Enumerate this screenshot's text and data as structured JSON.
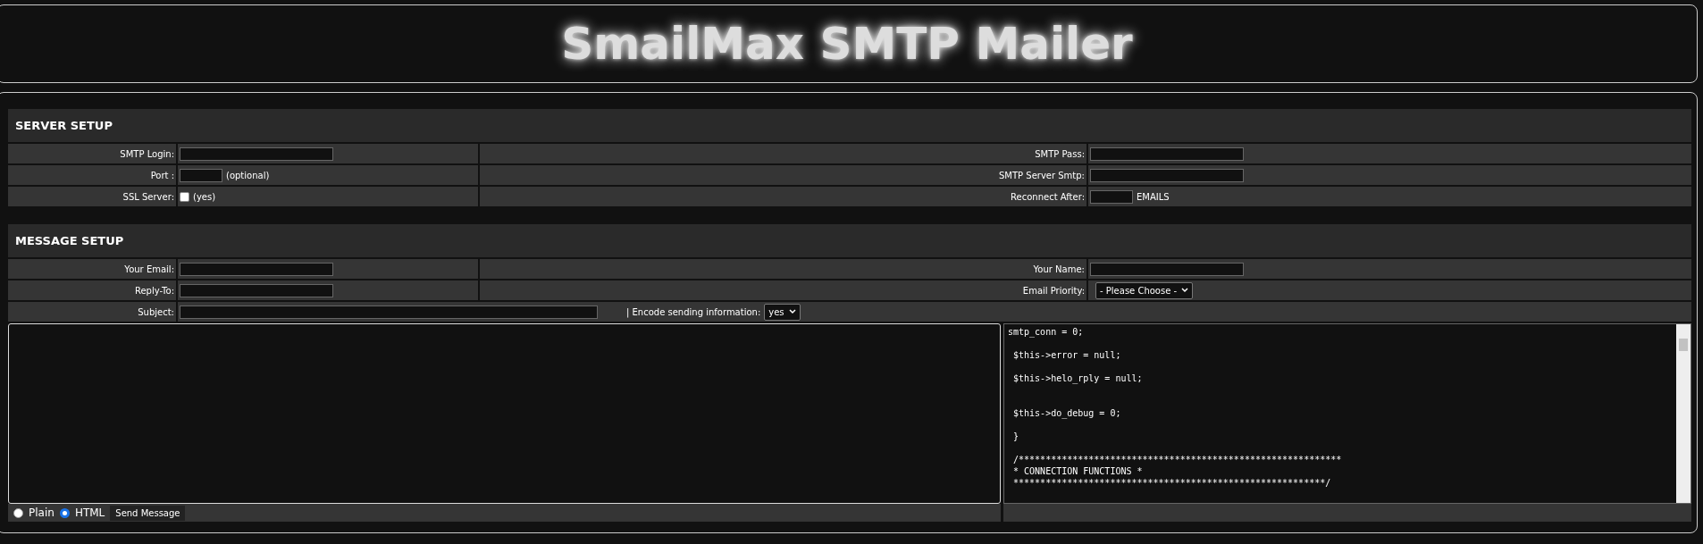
{
  "title": "SmailMax SMTP Mailer",
  "sections": [
    {
      "heading": "SERVER SETUP",
      "rows": [
        {
          "cells": [
            {
              "label": "SMTP Login:",
              "field": {
                "kind": "text"
              }
            },
            {
              "label": "SMTP Pass:",
              "field": {
                "kind": "text"
              }
            }
          ]
        },
        {
          "cells": [
            {
              "label": "Port :",
              "field": {
                "kind": "short",
                "note": "(optional)"
              }
            },
            {
              "label": "SMTP Server Smtp:",
              "field": {
                "kind": "text"
              }
            }
          ]
        },
        {
          "cells": [
            {
              "label": "SSL Server:",
              "field": {
                "kind": "checkbox",
                "checked": false,
                "note": "(yes)"
              }
            },
            {
              "label": "Reconnect After:",
              "field": {
                "kind": "short",
                "note": "EMAILS"
              }
            }
          ]
        }
      ]
    },
    {
      "heading": "MESSAGE SETUP",
      "rows": [
        {
          "cells": [
            {
              "label": "Your Email:",
              "field": {
                "kind": "text"
              }
            },
            {
              "label": "Your Name:",
              "field": {
                "kind": "text"
              }
            }
          ]
        },
        {
          "cells": [
            {
              "label": "Reply-To:",
              "field": {
                "kind": "text"
              }
            },
            {
              "label": "Email Priority:",
              "field": {
                "kind": "select",
                "value": "- Please Choose -"
              }
            }
          ]
        },
        {
          "cells": [
            {
              "label": "Subject:",
              "field": {
                "kind": "long"
              },
              "extra": {
                "label": "| Encode sending information:",
                "value": "yes"
              }
            }
          ]
        }
      ]
    }
  ],
  "formats": [
    {
      "label": "Plain",
      "selected": false
    },
    {
      "label": "HTML",
      "selected": true
    }
  ],
  "send_button": "Send Message",
  "code": "smtp_conn = 0;\n\n $this->error = null;\n\n $this->helo_rply = null;\n\n\n $this->do_debug = 0;\n\n }\n\n /************************************************************\n * CONNECTION FUNCTIONS *\n **********************************************************/"
}
